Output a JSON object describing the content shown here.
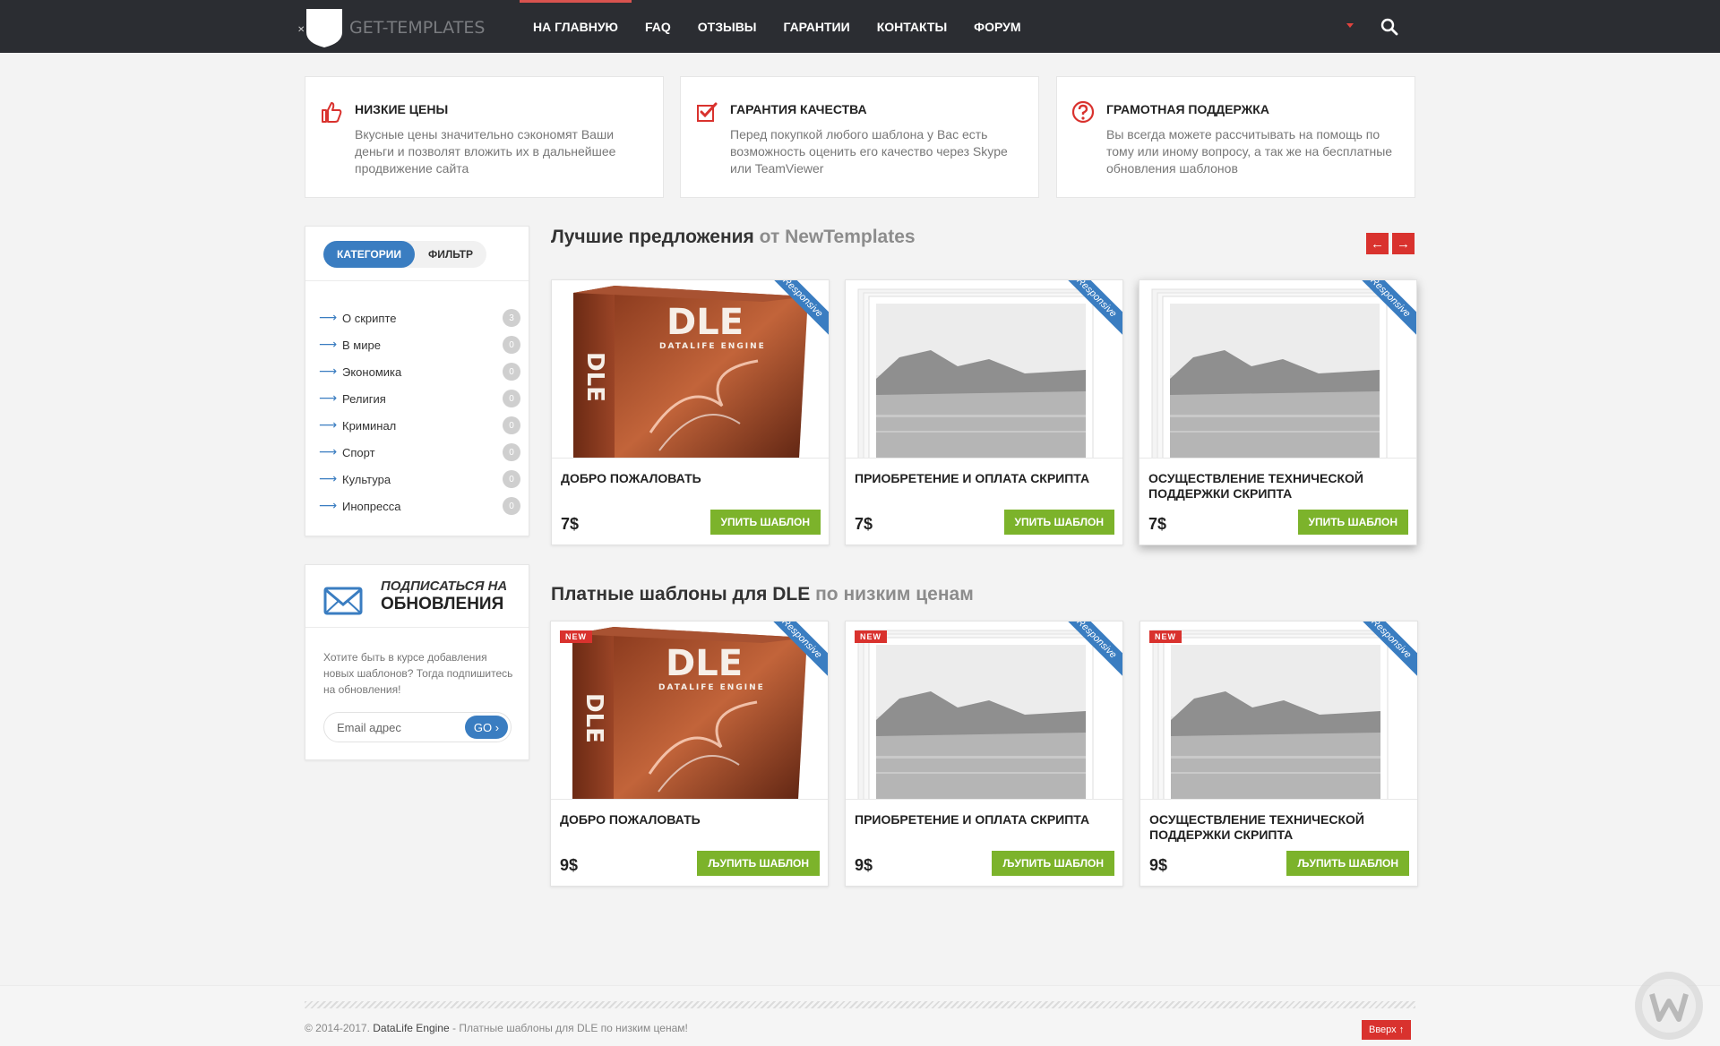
{
  "header": {
    "logo_text": "GET-TEMPLATES",
    "nav": [
      {
        "label": "На главную",
        "active": true
      },
      {
        "label": "FAQ",
        "active": false
      },
      {
        "label": "Отзывы",
        "active": false
      },
      {
        "label": "Гарантии",
        "active": false
      },
      {
        "label": "Контакты",
        "active": false
      },
      {
        "label": "Форум",
        "active": false
      }
    ],
    "icons": [
      "caret-down-icon",
      "search-icon"
    ]
  },
  "features": [
    {
      "icon": "thumbs-up-icon",
      "title": "Низкие цены",
      "text": "Вкусные цены значительно сэкономят Ваши деньги и позволят вложить их в дальнейшее продвижение сайта"
    },
    {
      "icon": "checkbox-icon",
      "title": "Гарантия качества",
      "text": "Перед покупкой любого шаблона у Вас есть возможность оценить его качество через Skype или TeamViewer"
    },
    {
      "icon": "question-icon",
      "title": "Грамотная поддержка",
      "text": "Вы всегда можете рассчитывать на помощь по тому или иному вопросу, а так же на бесплатные обновления шаблонов"
    }
  ],
  "sidebar": {
    "tabs": [
      {
        "label": "Категории",
        "active": true
      },
      {
        "label": "Фильтр",
        "active": false
      }
    ],
    "categories": [
      {
        "label": "О скрипте",
        "count": "3"
      },
      {
        "label": "В мире",
        "count": "0"
      },
      {
        "label": "Экономика",
        "count": "0"
      },
      {
        "label": "Религия",
        "count": "0"
      },
      {
        "label": "Криминал",
        "count": "0"
      },
      {
        "label": "Спорт",
        "count": "0"
      },
      {
        "label": "Культура",
        "count": "0"
      },
      {
        "label": "Инопресса",
        "count": "0"
      }
    ],
    "subscribe": {
      "title_top": "Подписаться на",
      "title_bottom": "обновления",
      "text": "Хотите быть в курсе добавления новых шаблонов? Тогда подпишитесь на обновления!",
      "placeholder": "Email адрес",
      "go_label": "GO ›"
    }
  },
  "best": {
    "title_main": "Лучшие предложения",
    "title_muted": "от NewTemplates",
    "prev_icon": "arrow-left-icon",
    "next_icon": "arrow-right-icon",
    "cards": [
      {
        "image": "dle-box",
        "ribbon": "Responsive",
        "title": "Добро пожаловать",
        "price": "7$",
        "buy": "упить шаблон"
      },
      {
        "image": "landscape",
        "ribbon": "Responsive",
        "title": "Приобретение и оплата скрипта",
        "price": "7$",
        "buy": "упить шаблон"
      },
      {
        "image": "landscape",
        "ribbon": "Responsive",
        "title": "Осуществление технической поддержки скрипта",
        "price": "7$",
        "buy": "упить шаблон"
      }
    ]
  },
  "paid": {
    "title_main": "Платные шаблоны для DLE",
    "title_muted": "по низким ценам",
    "cards": [
      {
        "image": "dle-box",
        "badge": "NEW",
        "ribbon": "Responsive",
        "title": "Добро пожаловать",
        "price": "9$",
        "buy": "ЉУПИТЬ ШАБЛОН"
      },
      {
        "image": "landscape",
        "badge": "NEW",
        "ribbon": "Responsive",
        "title": "Приобретение и оплата скрипта",
        "price": "9$",
        "buy": "ЉУПИТЬ ШАБЛОН"
      },
      {
        "image": "landscape",
        "badge": "NEW",
        "ribbon": "Responsive",
        "title": "Осуществление технической поддержки скрипта",
        "price": "9$",
        "buy": "ЉУПИТЬ ШАБЛОН"
      }
    ]
  },
  "footer": {
    "copy_prefix": "© 2014-2017.",
    "copy_brand": "DataLife Engine",
    "copy_suffix": "- Платные шаблоны для DLE по низким ценам!",
    "top_label": "Вверх ↑"
  },
  "colors": {
    "accent_blue": "#3a7dc1",
    "accent_red": "#d9322e",
    "buy_green": "#7cb32b",
    "header_bg": "#2b2d32"
  }
}
